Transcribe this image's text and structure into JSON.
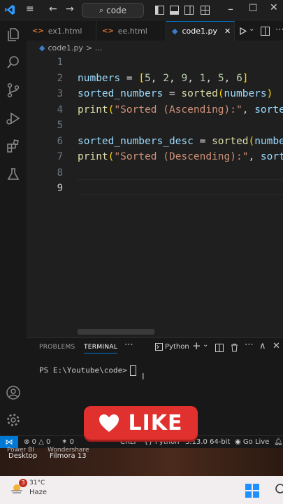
{
  "window": {
    "search_text": "code"
  },
  "tabs": [
    {
      "label": "ex1.html",
      "icon": "html-file-icon"
    },
    {
      "label": "ee.html",
      "icon": "html-file-icon"
    },
    {
      "label": "code1.py",
      "icon": "python-file-icon",
      "active": true
    }
  ],
  "breadcrumb": {
    "file": "code1.py",
    "more": "> ..."
  },
  "editor": {
    "line_numbers": [
      "1",
      "2",
      "3",
      "4",
      "5",
      "6",
      "7",
      "8",
      "9"
    ],
    "current_line": "9",
    "lines": [
      "",
      "numbers = [5, 2, 9, 1, 5, 6]",
      "sorted_numbers = sorted(numbers)",
      "print(\"Sorted (Ascending):\", sorted_numbers)",
      "",
      "sorted_numbers_desc = sorted(numbers, reverse=True)",
      "print(\"Sorted (Descending):\", sorted_numbers_desc)",
      "",
      ""
    ]
  },
  "panel": {
    "tabs": [
      "PROBLEMS",
      "TERMINAL"
    ],
    "active_tab": "TERMINAL",
    "shell_label": "Python",
    "prompt": "PS E:\\Youtube\\code>"
  },
  "status": {
    "errors": "0",
    "warnings": "0",
    "ports": "0",
    "eol": "CRLF",
    "language": "Python",
    "interpreter": "3.13.0 64-bit",
    "live": "Go Live"
  },
  "desktop": {
    "icons": [
      {
        "label": "Desktop",
        "caption": "Power BI"
      },
      {
        "label": "Filmora 13",
        "caption": "Wondershare"
      }
    ]
  },
  "taskbar": {
    "temperature": "31°C",
    "weather": "Haze",
    "badge": "3"
  },
  "overlay": {
    "like_text": "LIKE"
  },
  "colors": {
    "accent": "#0078d4",
    "like_red": "#e0312e",
    "editor_bg": "#1f1f1f"
  }
}
